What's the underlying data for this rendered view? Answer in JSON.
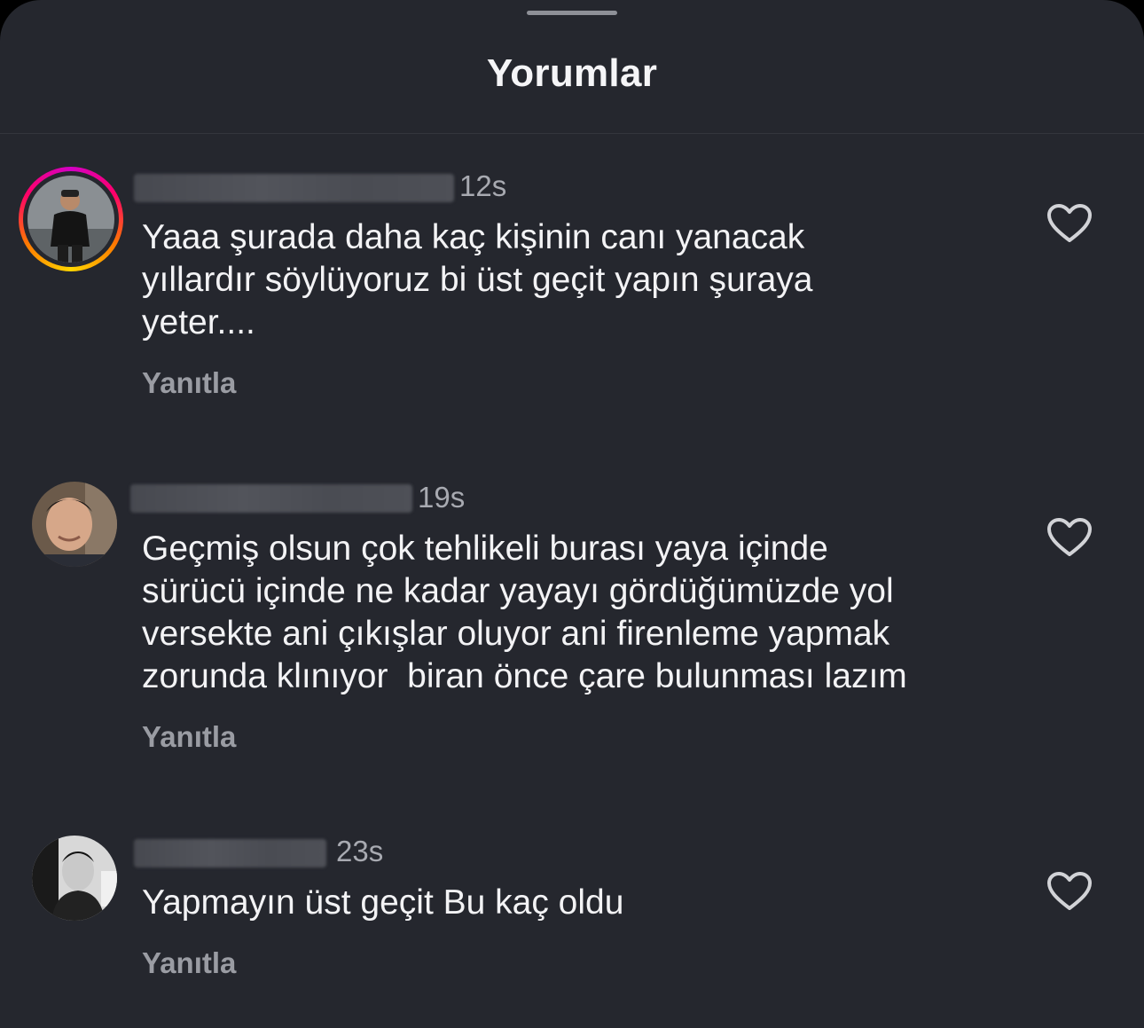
{
  "header": {
    "title": "Yorumlar"
  },
  "comments": [
    {
      "time": "12s",
      "text": "Yaaa şurada daha kaç kişinin canı yanacak\nyıllardır söylüyoruz bi üst geçit yapın şuraya\nyeter....",
      "reply_label": "Yanıtla",
      "like_icon": "heart-outline-icon"
    },
    {
      "time": "19s",
      "text": "Geçmiş olsun çok tehlikeli burası yaya içinde\nsürücü içinde ne kadar yayayı gördüğümüzde yol\nversekte ani çıkışlar oluyor ani firenleme yapmak\nzorunda klınıyor  biran önce çare bulunması lazım",
      "reply_label": "Yanıtla",
      "like_icon": "heart-outline-icon"
    },
    {
      "time": "23s",
      "text": "Yapmayın üst geçit Bu kaç oldu",
      "reply_label": "Yanıtla",
      "like_icon": "heart-outline-icon"
    }
  ],
  "colors": {
    "background": "#25272e",
    "text": "#f3f3f5",
    "muted": "#9a9ca3",
    "story_ring": "#ff0069"
  }
}
